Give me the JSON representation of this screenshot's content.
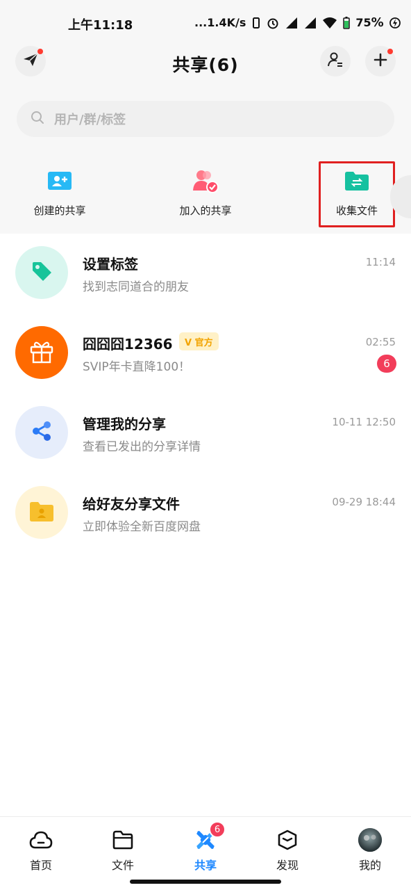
{
  "status_bar": {
    "time": "上午11:18",
    "network_speed": "...1.4K/s",
    "battery": "75",
    "battery_unit": "%"
  },
  "header": {
    "title": "共享(6)"
  },
  "search": {
    "placeholder": "用户/群/标签"
  },
  "quick_actions": [
    {
      "label": "创建的共享",
      "icon": "create-share-icon"
    },
    {
      "label": "加入的共享",
      "icon": "joined-share-icon"
    },
    {
      "label": "收集文件",
      "icon": "collect-files-folder-icon"
    }
  ],
  "list": [
    {
      "title": "设置标签",
      "subtitle": "找到志同道合的朋友",
      "time": "11:14",
      "icon": "tag-icon",
      "color": "#d9f6ef"
    },
    {
      "title": "囧囧囧12366",
      "badge": "V 官方",
      "subtitle": "SVIP年卡直降100！",
      "time": "02:55",
      "unread": "6",
      "icon": "gift-icon",
      "color": "#ff6a00"
    },
    {
      "title": "管理我的分享",
      "subtitle": "查看已发出的分享详情",
      "time": "10-11 12:50",
      "icon": "share-icon",
      "color": "#e6edfb"
    },
    {
      "title": "给好友分享文件",
      "subtitle": "立即体验全新百度网盘",
      "time": "09-29 18:44",
      "icon": "folder-user-icon",
      "color": "#fff4d6"
    }
  ],
  "bottom_nav": [
    {
      "label": "首页",
      "icon": "cloud-icon"
    },
    {
      "label": "文件",
      "icon": "folder-icon"
    },
    {
      "label": "共享",
      "icon": "share-tab-icon",
      "active": true,
      "badge": "6"
    },
    {
      "label": "发现",
      "icon": "discover-box-icon"
    },
    {
      "label": "我的",
      "icon": "profile-avatar"
    }
  ],
  "colors": {
    "accent": "#1e88ff",
    "badge": "#f23d5a",
    "highlight": "#e02020"
  }
}
